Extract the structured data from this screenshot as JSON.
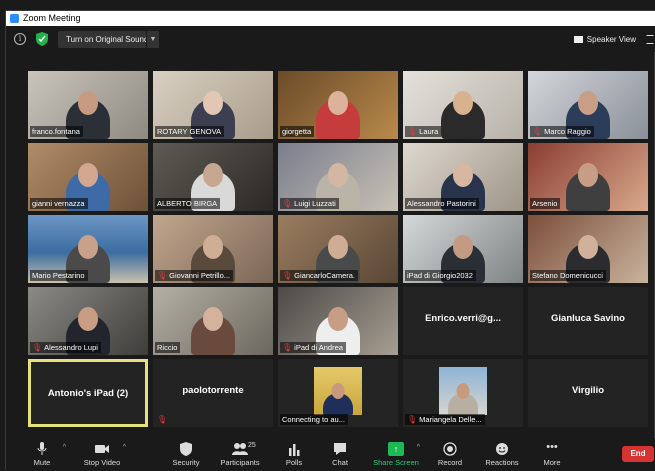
{
  "window": {
    "title": "Zoom Meeting"
  },
  "topbar": {
    "sound_button": "Turn on Original Sound",
    "view_button": "Speaker View"
  },
  "participants": [
    {
      "name": "franco.fontana",
      "muted": false
    },
    {
      "name": "ROTARY GENOVA",
      "muted": false
    },
    {
      "name": "giorgetta",
      "muted": false
    },
    {
      "name": "Laura",
      "muted": true
    },
    {
      "name": "Marco Raggio",
      "muted": true
    },
    {
      "name": "gianni vernazza",
      "muted": false
    },
    {
      "name": "ALBERTO BIRGA",
      "muted": false
    },
    {
      "name": "Luigi Luzzati",
      "muted": true
    },
    {
      "name": "Alessandro Pastorini",
      "muted": false
    },
    {
      "name": "Arsenio",
      "muted": false
    },
    {
      "name": "Mario Pestarino",
      "muted": false
    },
    {
      "name": "Giovanni Petrillo...",
      "muted": true
    },
    {
      "name": "GiancarloCamera.",
      "muted": true
    },
    {
      "name": "iPad di Giorgio2032",
      "muted": false
    },
    {
      "name": "Stefano Domenicucci",
      "muted": false
    },
    {
      "name": "Alessandro Lupi",
      "muted": true
    },
    {
      "name": "Riccio",
      "muted": false
    },
    {
      "name": "iPad di Andrea",
      "muted": true
    },
    {
      "name": "Enrico.verri@g...",
      "muted": false
    },
    {
      "name": "Gianluca Savino",
      "muted": false
    },
    {
      "name": "Antonio's iPad (2)",
      "muted": false
    },
    {
      "name": "paolotorrente",
      "muted": true
    },
    {
      "name": "Connecting to au...",
      "muted": false
    },
    {
      "name": "Mariangela Delle...",
      "muted": true
    },
    {
      "name": "Virgilio",
      "muted": false
    }
  ],
  "toolbar": {
    "mute": "Mute",
    "stop_video": "Stop Video",
    "security": "Security",
    "participants": "Participants",
    "participants_count": "25",
    "polls": "Polls",
    "chat": "Chat",
    "share_screen": "Share Screen",
    "record": "Record",
    "reactions": "Reactions",
    "more": "More",
    "end": "End"
  },
  "colors": {
    "accent": "#2d8cff",
    "share": "#1db954",
    "end": "#d63333",
    "active_speaker": "#e8e07a",
    "muted": "#e5383b"
  }
}
